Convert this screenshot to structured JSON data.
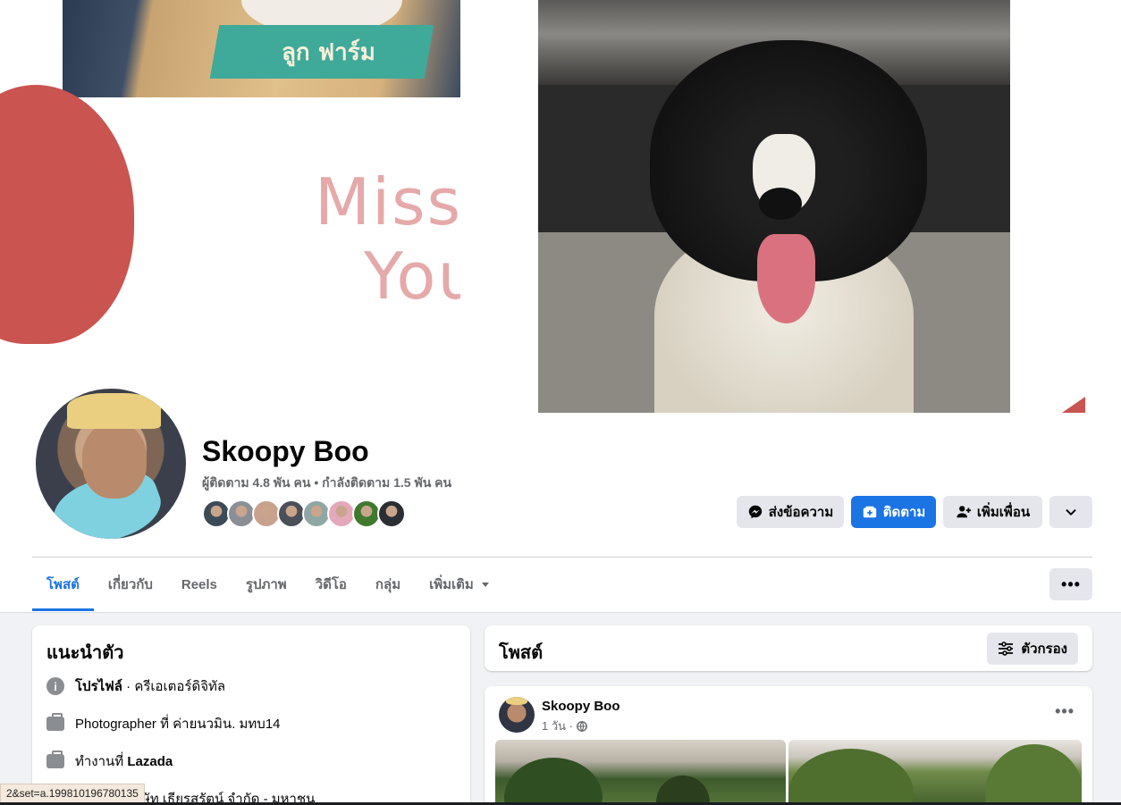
{
  "cover": {
    "left_photo_text": "ลูก ฟาร์ม",
    "miss_text_line1": "Miss",
    "miss_text_line2": "You"
  },
  "profile": {
    "name": "Skoopy Boo",
    "stats": "ผู้ติดตาม 4.8 พัน คน • กำลังติดตาม 1.5 พัน คน",
    "friend_avatar_colors": [
      "#3d4a57",
      "#8a8f96",
      "#c9a28f",
      "#4a4f58",
      "#8fa7a4",
      "#e3a8b9",
      "#3f7a2e",
      "#2b2e33"
    ]
  },
  "actions": {
    "message_label": "ส่งข้อความ",
    "follow_label": "ติดตาม",
    "add_friend_label": "เพิ่มเพื่อน"
  },
  "tabs": [
    {
      "label": "โพสต์"
    },
    {
      "label": "เกี่ยวกับ"
    },
    {
      "label": "Reels"
    },
    {
      "label": "รูปภาพ"
    },
    {
      "label": "วิดีโอ"
    },
    {
      "label": "กลุ่ม"
    },
    {
      "label": "เพิ่มเติม"
    }
  ],
  "intro": {
    "title": "แนะนำตัว",
    "profile_label": "โปรไฟล์",
    "profile_category": " · ครีเอเตอร์ดิจิทัล",
    "job_text": "Photographer ที่ ค่ายนวมิน. มทบ14",
    "work_prefix": "ทำงานที่ ",
    "work_company": "Lazada",
    "partial_row": "ร. บริษัท เธียรสรัตน์ จำกัด - มหาชน"
  },
  "posts_header": {
    "title": "โพสต์",
    "filter_label": "ตัวกรอง"
  },
  "post": {
    "author": "Skoopy Boo",
    "time": "1 วัน ·"
  },
  "status_bar": {
    "url": "2&set=a.199810196780135"
  },
  "colors": {
    "accent": "#1b74e4",
    "page_bg": "#f0f2f5",
    "button_gray": "#e4e6eb"
  }
}
